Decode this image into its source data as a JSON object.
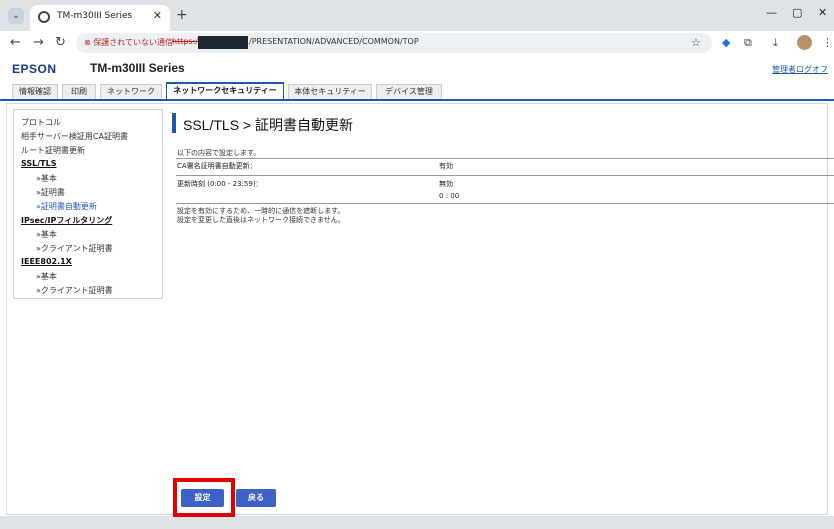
{
  "browser": {
    "tab_title": "TM-m30III Series",
    "not_secure_label": "保護されていない通信",
    "url_scheme": "https://",
    "url_path": "/PRESENTATION/ADVANCED/COMMON/TOP"
  },
  "header": {
    "brand": "EPSON",
    "model": "TM-m30III Series",
    "logout": "管理者ログオフ"
  },
  "main_tabs": [
    {
      "label": "情報確認"
    },
    {
      "label": "印刷"
    },
    {
      "label": "ネットワーク"
    },
    {
      "label": "ネットワークセキュリティー",
      "active": true
    },
    {
      "label": "本体セキュリティー"
    },
    {
      "label": "デバイス管理"
    }
  ],
  "sidebar": {
    "items": [
      {
        "label": "プロトコル"
      },
      {
        "label": "相手サーバー検証用CA証明書"
      },
      {
        "label": "ルート証明書更新"
      },
      {
        "label": "SSL/TLS"
      },
      {
        "label": "»基本"
      },
      {
        "label": "»証明書"
      },
      {
        "label": "»証明書自動更新"
      },
      {
        "label": "IPsec/IPフィルタリング"
      },
      {
        "label": "»基本"
      },
      {
        "label": "»クライアント証明書"
      },
      {
        "label": "IEEE802.1X"
      },
      {
        "label": "»基本"
      },
      {
        "label": "»クライアント証明書"
      }
    ]
  },
  "main": {
    "title": "SSL/TLS > 証明書自動更新",
    "intro": "以下の内容で設定します。",
    "rows": [
      {
        "label": "CA署名証明書自動更新：",
        "value": "有効"
      },
      {
        "label": "更新時刻 (0:00 - 23:59)：",
        "value": "無効",
        "value2": "0 : 00"
      }
    ],
    "notes": [
      "設定を有効にするため、一時的に通信を遮断します。",
      "設定を変更した直後はネットワーク接続できません。"
    ]
  },
  "buttons": {
    "ok": "設定",
    "back": "戻る"
  },
  "colors": {
    "accent": "#1f57b8",
    "button": "#3b62c4",
    "highlight": "#e00000"
  }
}
